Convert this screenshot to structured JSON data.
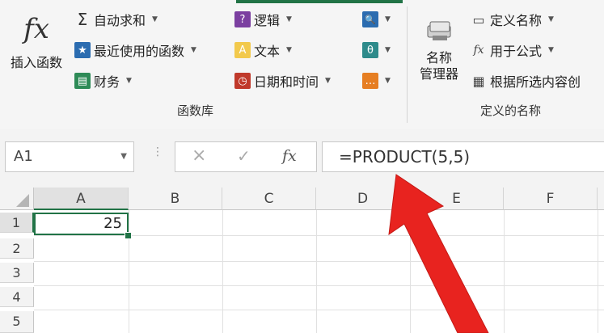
{
  "ribbon": {
    "insert_function": {
      "icon": "fx",
      "label": "插入函数"
    },
    "buttons_col1": [
      {
        "label": "自动求和",
        "icon": "Σ"
      },
      {
        "label": "最近使用的函数",
        "icon": "★"
      },
      {
        "label": "财务",
        "icon": "▤"
      }
    ],
    "buttons_col2": [
      {
        "label": "逻辑",
        "icon": "?"
      },
      {
        "label": "文本",
        "icon": "A"
      },
      {
        "label": "日期和时间",
        "icon": "◷"
      }
    ],
    "buttons_col3": [
      {
        "icon": "🔍"
      },
      {
        "icon": "θ"
      },
      {
        "icon": "…"
      }
    ],
    "group_function_library": "函数库",
    "name_manager": {
      "label_line1": "名称",
      "label_line2": "管理器"
    },
    "buttons_col4": [
      {
        "label": "定义名称",
        "icon": "▭"
      },
      {
        "label": "用于公式",
        "icon": "fx"
      },
      {
        "label": "根据所选内容创",
        "icon": "▦"
      }
    ],
    "group_defined_names": "定义的名称"
  },
  "formula_bar": {
    "name_box": "A1",
    "cancel_icon": "×",
    "enter_icon": "✓",
    "fx_icon": "fx",
    "formula": "=PRODUCT(5,5)"
  },
  "grid": {
    "columns": [
      "A",
      "B",
      "C",
      "D",
      "E",
      "F"
    ],
    "rows": [
      "1",
      "2",
      "3",
      "4",
      "5"
    ],
    "cell_a1": "25"
  },
  "colors": {
    "accent": "#217346",
    "arrow": "#e8231f"
  }
}
